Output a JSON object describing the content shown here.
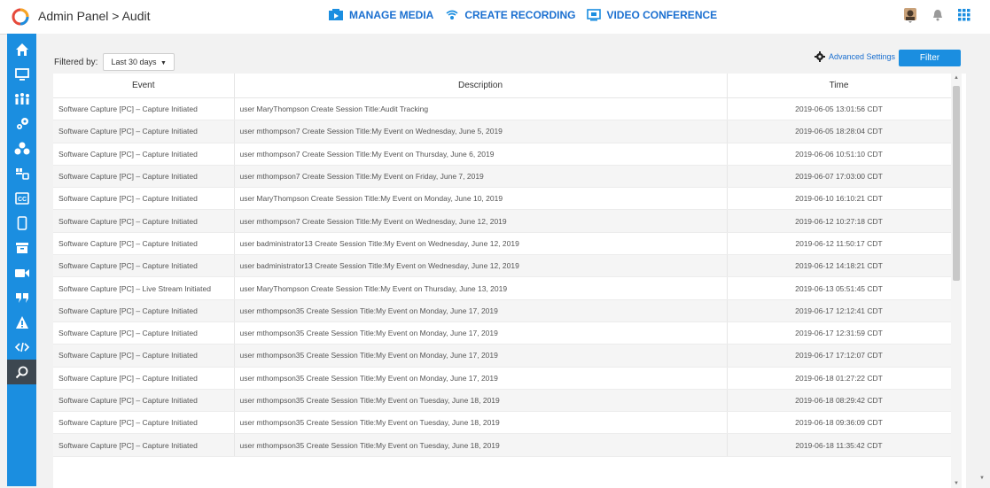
{
  "header": {
    "breadcrumb_root": "Admin Panel",
    "breadcrumb_sep": ">",
    "breadcrumb_page": "Audit",
    "nav": [
      {
        "label": "MANAGE MEDIA",
        "icon": "media-icon"
      },
      {
        "label": "CREATE RECORDING",
        "icon": "recording-icon"
      },
      {
        "label": "VIDEO CONFERENCE",
        "icon": "conference-icon"
      }
    ]
  },
  "toolbar": {
    "filtered_by_label": "Filtered by:",
    "filter_value": "Last 30 days",
    "advanced_settings": "Advanced Settings",
    "filter_button": "Filter"
  },
  "table": {
    "columns": [
      "Event",
      "Description",
      "Time"
    ],
    "rows": [
      [
        "Software Capture [PC] – Capture Initiated",
        "user MaryThompson Create Session Title:Audit Tracking",
        "2019-06-05 13:01:56 CDT"
      ],
      [
        "Software Capture [PC] – Capture Initiated",
        "user mthompson7 Create Session Title:My Event on Wednesday, June 5, 2019",
        "2019-06-05 18:28:04 CDT"
      ],
      [
        "Software Capture [PC] – Capture Initiated",
        "user mthompson7 Create Session Title:My Event on Thursday, June 6, 2019",
        "2019-06-06 10:51:10 CDT"
      ],
      [
        "Software Capture [PC] – Capture Initiated",
        "user mthompson7 Create Session Title:My Event on Friday, June 7, 2019",
        "2019-06-07 17:03:00 CDT"
      ],
      [
        "Software Capture [PC] – Capture Initiated",
        "user MaryThompson Create Session Title:My Event on Monday, June 10, 2019",
        "2019-06-10 16:10:21 CDT"
      ],
      [
        "Software Capture [PC] – Capture Initiated",
        "user mthompson7 Create Session Title:My Event on Wednesday, June 12, 2019",
        "2019-06-12 10:27:18 CDT"
      ],
      [
        "Software Capture [PC] – Capture Initiated",
        "user badministrator13 Create Session Title:My Event on Wednesday, June 12, 2019",
        "2019-06-12 11:50:17 CDT"
      ],
      [
        "Software Capture [PC] – Capture Initiated",
        "user badministrator13 Create Session Title:My Event on Wednesday, June 12, 2019",
        "2019-06-12 14:18:21 CDT"
      ],
      [
        "Software Capture [PC] – Live Stream Initiated",
        "user MaryThompson Create Session Title:My Event on Thursday, June 13, 2019",
        "2019-06-13 05:51:45 CDT"
      ],
      [
        "Software Capture [PC] – Capture Initiated",
        "user mthompson35 Create Session Title:My Event on Monday, June 17, 2019",
        "2019-06-17 12:12:41 CDT"
      ],
      [
        "Software Capture [PC] – Capture Initiated",
        "user mthompson35 Create Session Title:My Event on Monday, June 17, 2019",
        "2019-06-17 12:31:59 CDT"
      ],
      [
        "Software Capture [PC] – Capture Initiated",
        "user mthompson35 Create Session Title:My Event on Monday, June 17, 2019",
        "2019-06-17 17:12:07 CDT"
      ],
      [
        "Software Capture [PC] – Capture Initiated",
        "user mthompson35 Create Session Title:My Event on Monday, June 17, 2019",
        "2019-06-18 01:27:22 CDT"
      ],
      [
        "Software Capture [PC] – Capture Initiated",
        "user mthompson35 Create Session Title:My Event on Tuesday, June 18, 2019",
        "2019-06-18 08:29:42 CDT"
      ],
      [
        "Software Capture [PC] – Capture Initiated",
        "user mthompson35 Create Session Title:My Event on Tuesday, June 18, 2019",
        "2019-06-18 09:36:09 CDT"
      ],
      [
        "Software Capture [PC] – Capture Initiated",
        "user mthompson35 Create Session Title:My Event on Tuesday, June 18, 2019",
        "2019-06-18 11:35:42 CDT"
      ]
    ]
  },
  "sidebar": {
    "items": [
      "home-icon",
      "monitor-icon",
      "users-icon",
      "integrations-icon",
      "groups-icon",
      "settings-icon",
      "captions-icon",
      "mobile-icon",
      "archive-icon",
      "video-icon",
      "quote-icon",
      "warning-icon",
      "code-icon",
      "audit-icon"
    ]
  },
  "colors": {
    "accent": "#1b8ee0",
    "sidebar_active": "#3d4750"
  }
}
